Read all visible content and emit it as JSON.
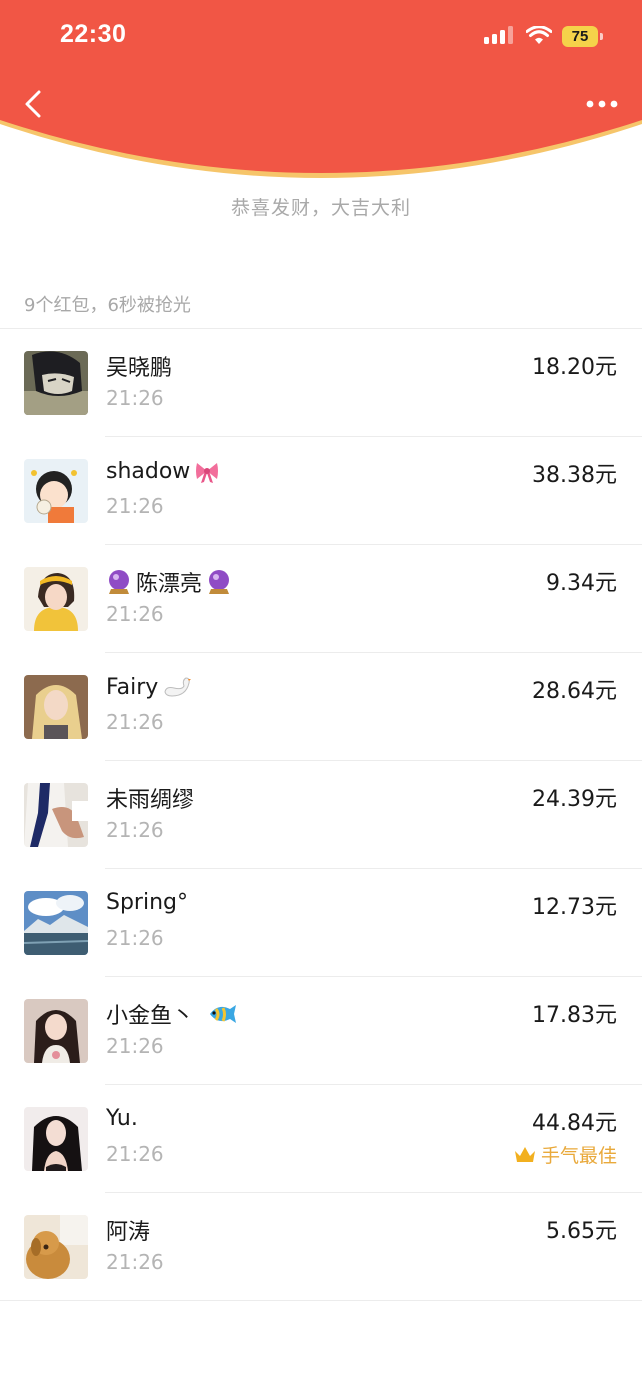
{
  "status_bar": {
    "time": "22:30",
    "battery": "75"
  },
  "header": {
    "greeting": "恭喜发财，大吉大利"
  },
  "summary": "9个红包，6秒被抢光",
  "colors": {
    "header_red": "#f15645",
    "curve_gold": "#f6c56a",
    "best_gold": "#e9a93b"
  },
  "recipients": [
    {
      "name": "吴晓鹏",
      "time": "21:26",
      "amount": "18.20元"
    },
    {
      "name": "shadow",
      "name_emoji": "bow-emoji",
      "time": "21:26",
      "amount": "38.38元"
    },
    {
      "name": "陈漂亮",
      "name_emoji": "crystal-ball-emoji",
      "time": "21:26",
      "amount": "9.34元"
    },
    {
      "name": "Fairy",
      "name_emoji": "swan-emoji",
      "time": "21:26",
      "amount": "28.64元"
    },
    {
      "name": "未雨绸缪",
      "time": "21:26",
      "amount": "24.39元"
    },
    {
      "name": "Spring°",
      "time": "21:26",
      "amount": "12.73元"
    },
    {
      "name": "小金鱼丶",
      "name_emoji": "tropical-fish-emoji",
      "time": "21:26",
      "amount": "17.83元"
    },
    {
      "name": "Yu.",
      "time": "21:26",
      "amount": "44.84元",
      "badge": "手气最佳"
    },
    {
      "name": "阿涛",
      "time": "21:26",
      "amount": "5.65元"
    }
  ]
}
